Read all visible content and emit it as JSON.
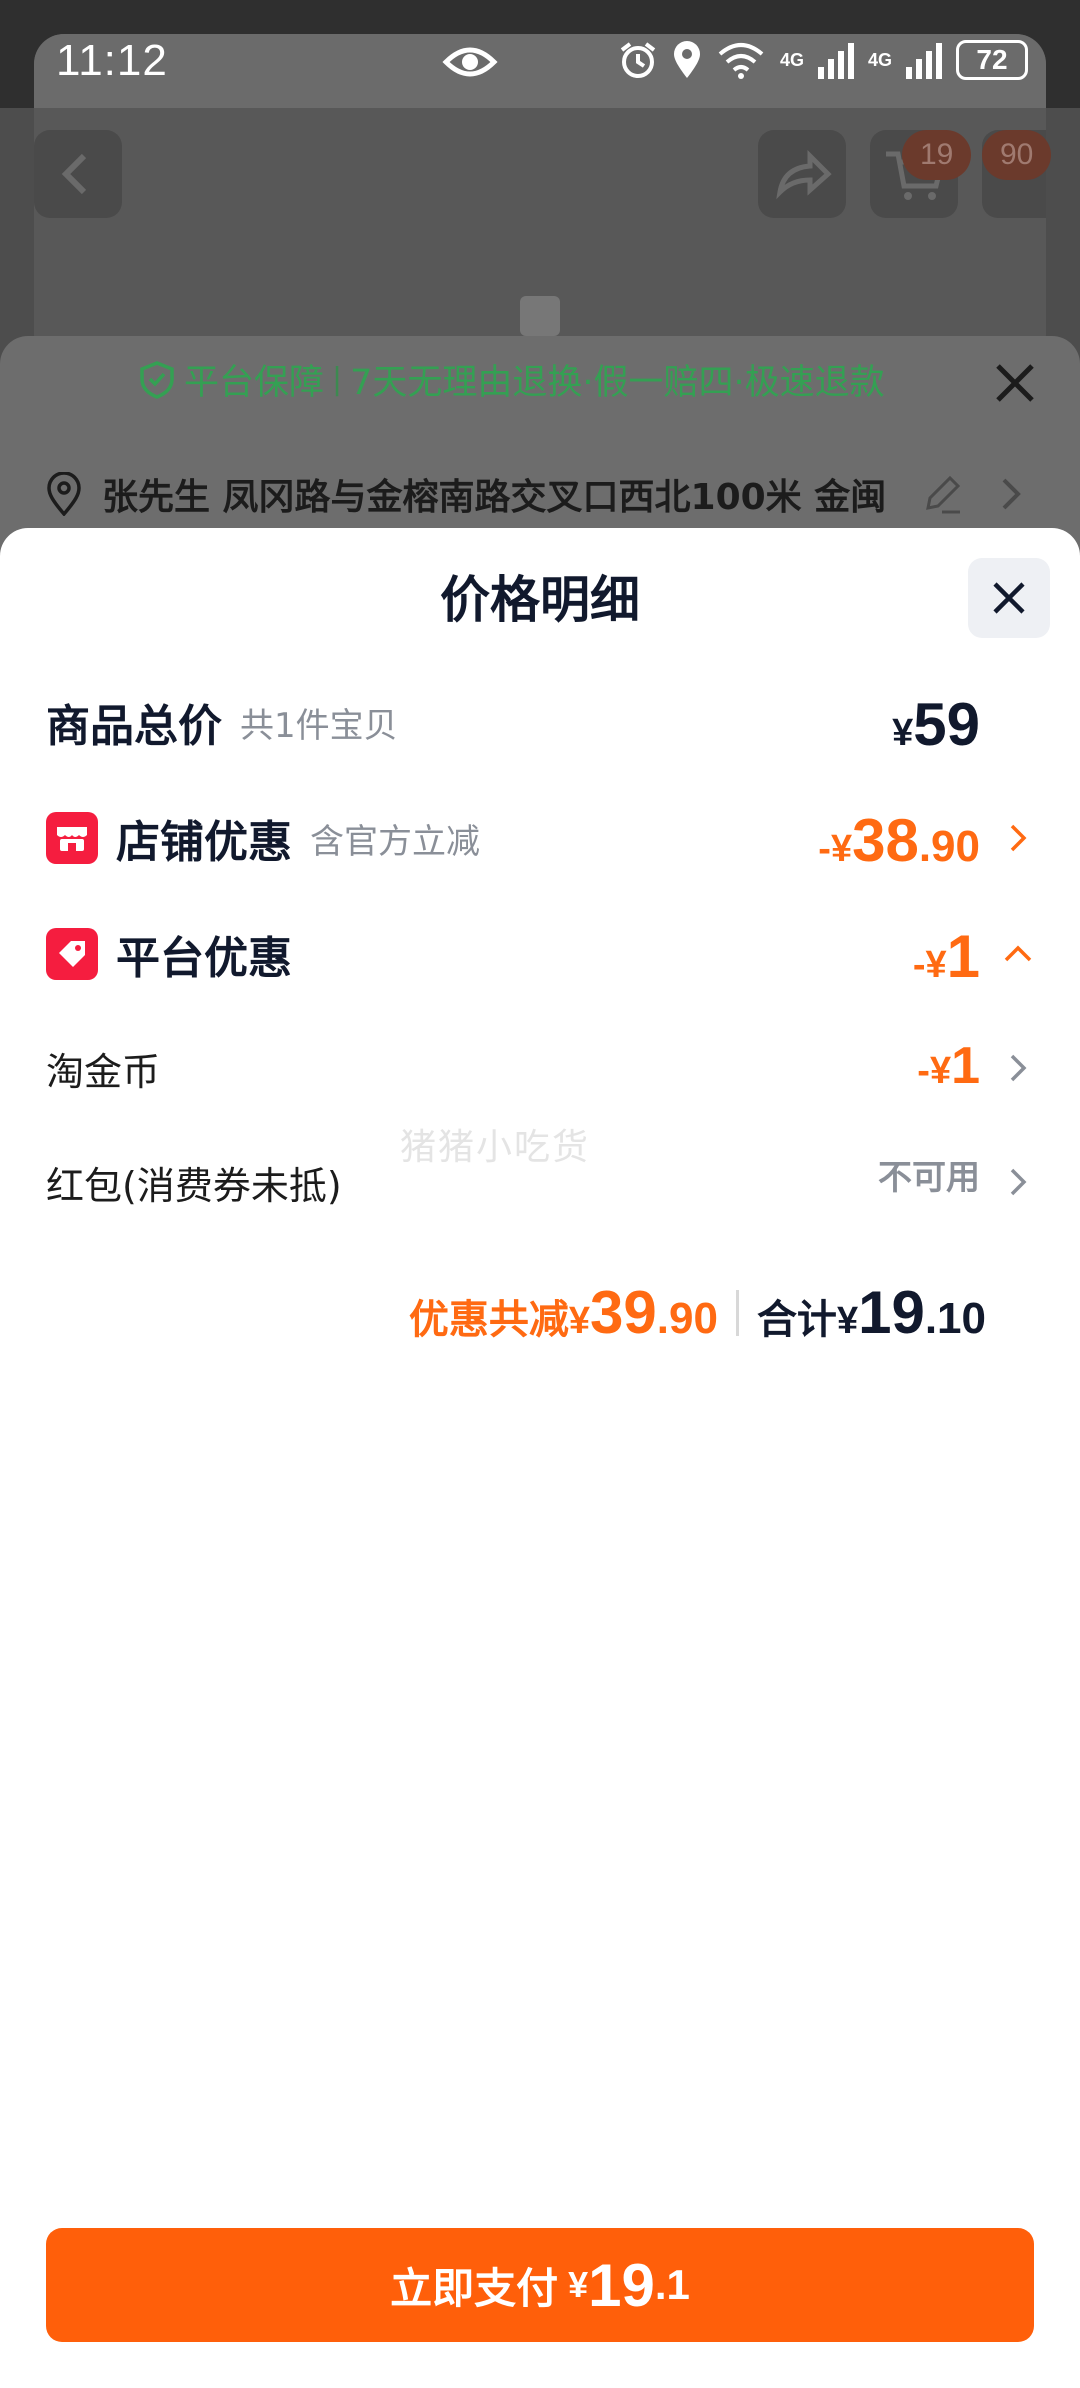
{
  "status_bar": {
    "time": "11:12",
    "battery": "72",
    "network_1": "4G",
    "network_2": "4G"
  },
  "background": {
    "cart_badge": "19",
    "more_badge": "90",
    "guarantee": {
      "title": "平台保障",
      "terms": "7天无理由退换·假一赔四·极速退款"
    },
    "address": "张先生 凤冈路与金榕南路交叉口西北100米 金闽"
  },
  "sheet": {
    "title": "价格明细",
    "rows": [
      {
        "label": "商品总价",
        "sub": "共1件宝贝",
        "currency": "¥",
        "value_int": "59",
        "value_dec": ""
      },
      {
        "label": "店铺优惠",
        "sub": "含官方立减",
        "prefix": "-",
        "currency": "¥",
        "value_int": "38",
        "value_dec": ".90"
      },
      {
        "label": "平台优惠",
        "prefix": "-",
        "currency": "¥",
        "value_int": "1",
        "value_dec": ""
      },
      {
        "label": "淘金币",
        "prefix": "-",
        "currency": "¥",
        "value_int": "1",
        "value_dec": ""
      },
      {
        "label": "红包(消费券未抵)",
        "value_text": "不可用"
      }
    ],
    "watermark": "猪猪小吃货",
    "summary": {
      "discount_label": "优惠共减",
      "discount_currency": "¥",
      "discount_int": "39",
      "discount_dec": ".90",
      "total_label": "合计",
      "total_currency": "¥",
      "total_int": "19",
      "total_dec": ".10"
    },
    "pay_button": {
      "label": "立即支付",
      "currency": "¥",
      "amount_int": "19",
      "amount_dec": ".1"
    }
  },
  "colors": {
    "accent": "#ff6a12",
    "pay_button": "#ff5f0a",
    "icon_red": "#f51d3f",
    "guarantee_green": "#34a053"
  }
}
